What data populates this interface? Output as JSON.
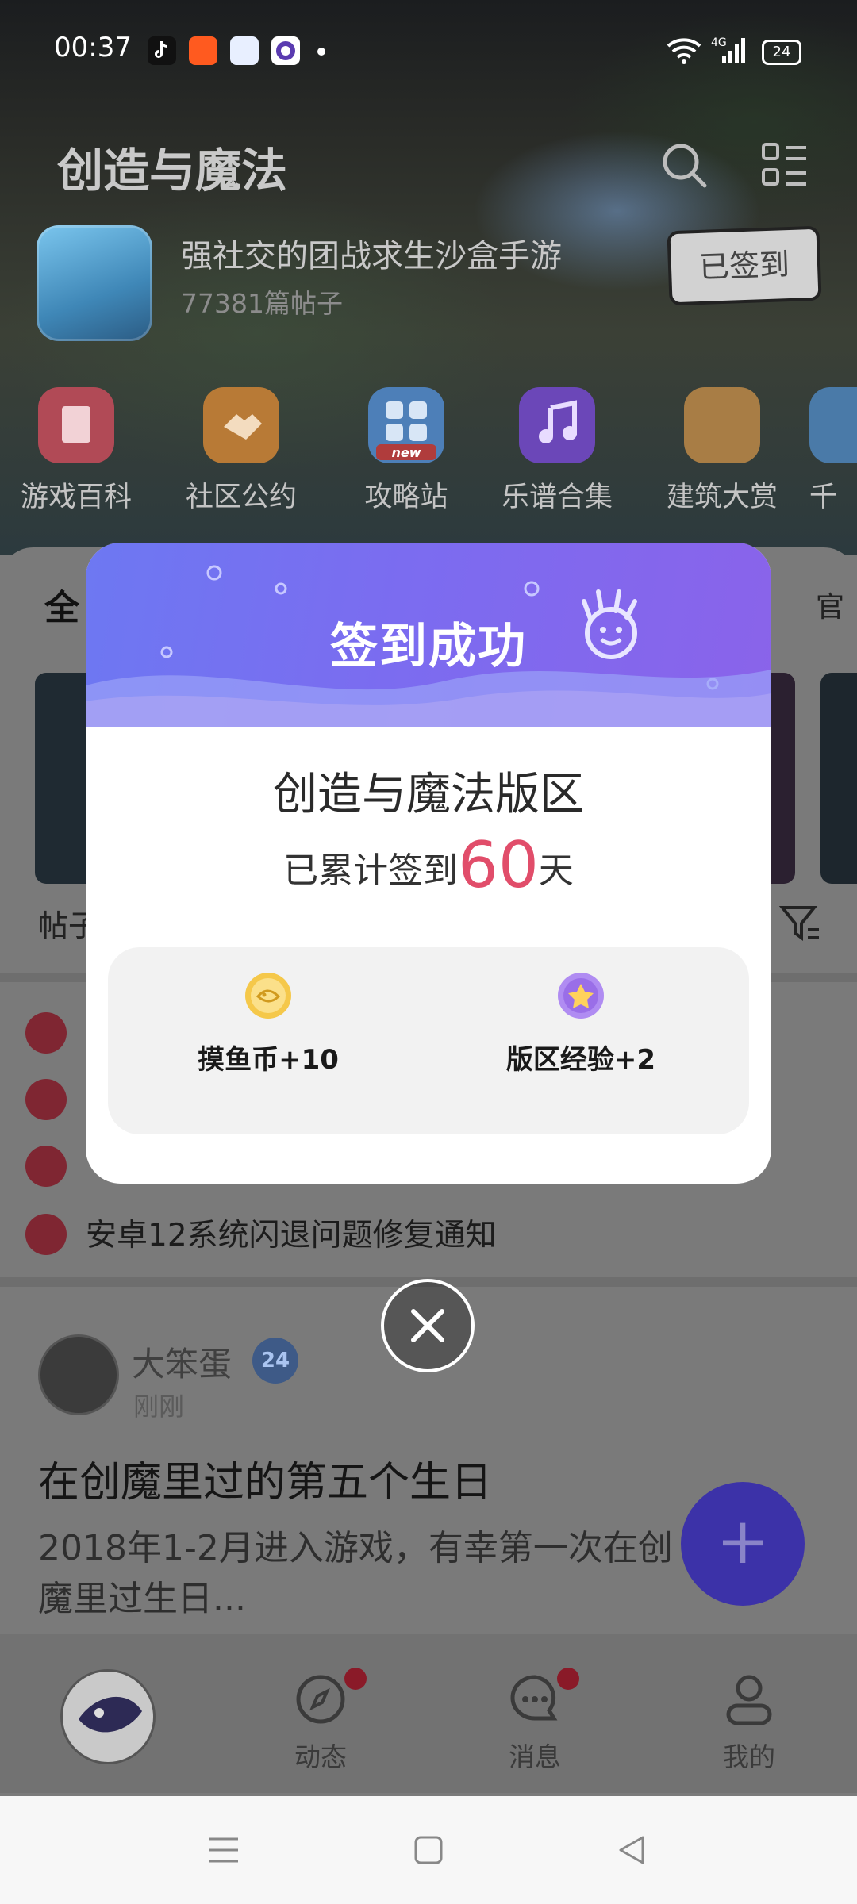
{
  "status_bar": {
    "time": "00:37",
    "battery": "24",
    "network": "4G"
  },
  "header": {
    "title": "创造与魔法",
    "subtitle": "强社交的团战求生沙盒手游",
    "post_count": "77381篇帖子",
    "signed_label": "已签到"
  },
  "shortcuts": [
    {
      "label": "游戏百科",
      "color": "#f0606e"
    },
    {
      "label": "社区公约",
      "color": "#f29a3a"
    },
    {
      "label": "攻略站",
      "color": "#5aa0ee",
      "tag": "new"
    },
    {
      "label": "乐谱合集",
      "color": "#8a5cf0"
    },
    {
      "label": "建筑大赏",
      "color": "#e8a24a"
    },
    {
      "label": "千"
    }
  ],
  "tabs_partial": {
    "left": "全",
    "right": "官"
  },
  "feed_labels": {
    "posts_partial": "帖子"
  },
  "notices": [
    {
      "text": "安卓12系统闪退问题修复通知"
    }
  ],
  "post": {
    "author": "大笨蛋",
    "level": "24",
    "time": "刚刚",
    "title": "在创魔里过的第五个生日",
    "body": "2018年1-2月进入游戏，有幸第一次在创魔里过生日..."
  },
  "fab_label": "+",
  "bottom_nav": {
    "items": [
      {
        "label": "动态"
      },
      {
        "label": "消息"
      },
      {
        "label": "我的"
      }
    ]
  },
  "modal": {
    "title": "签到成功",
    "zone_name": "创造与魔法版区",
    "days_prefix": "已累计签到",
    "days_value": "60",
    "days_suffix": "天",
    "rewards": [
      {
        "label": "摸鱼币+10",
        "icon": "coin-icon"
      },
      {
        "label": "版区经验+2",
        "icon": "medal-icon"
      }
    ]
  },
  "colors": {
    "accent": "#7b6cf0",
    "days_number": "#e14d6a",
    "fab": "#3c32a8"
  }
}
